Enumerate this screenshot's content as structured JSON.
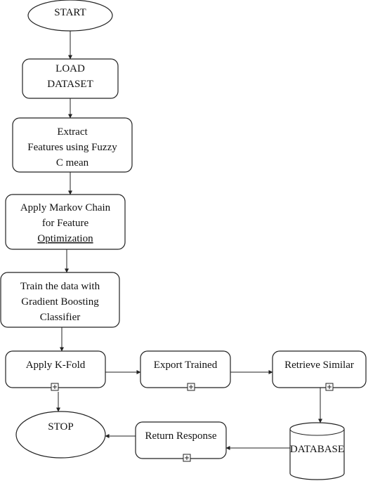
{
  "nodes": [
    {
      "id": "start",
      "shape": "ellipse",
      "lines": [
        "START"
      ]
    },
    {
      "id": "load",
      "shape": "rounded-rect",
      "lines": [
        "LOAD",
        "DATASET"
      ]
    },
    {
      "id": "extract",
      "shape": "rounded-rect",
      "lines": [
        "Extract",
        "Features using Fuzzy",
        "C mean"
      ]
    },
    {
      "id": "markov",
      "shape": "rounded-rect",
      "lines": [
        "Apply Markov Chain",
        "for Feature",
        "Optimization"
      ]
    },
    {
      "id": "train",
      "shape": "rounded-rect",
      "lines": [
        "Train the data with",
        "Gradient Boosting",
        "Classifier"
      ]
    },
    {
      "id": "kfold",
      "shape": "rounded-rect",
      "lines": [
        "Apply K-Fold"
      ],
      "expand_marker": true
    },
    {
      "id": "export",
      "shape": "rounded-rect",
      "lines": [
        "Export Trained"
      ],
      "expand_marker": true
    },
    {
      "id": "retrieve",
      "shape": "rounded-rect",
      "lines": [
        "Retrieve Similar"
      ],
      "expand_marker": true
    },
    {
      "id": "database",
      "shape": "cylinder",
      "lines": [
        "DATABASE"
      ]
    },
    {
      "id": "response",
      "shape": "rounded-rect",
      "lines": [
        "Return Response"
      ],
      "expand_marker": true
    },
    {
      "id": "stop",
      "shape": "ellipse",
      "lines": [
        "STOP"
      ]
    }
  ],
  "edges": [
    [
      "start",
      "load"
    ],
    [
      "load",
      "extract"
    ],
    [
      "extract",
      "markov"
    ],
    [
      "markov",
      "train"
    ],
    [
      "train",
      "kfold"
    ],
    [
      "kfold",
      "export"
    ],
    [
      "export",
      "retrieve"
    ],
    [
      "retrieve",
      "database"
    ],
    [
      "database",
      "response"
    ],
    [
      "response",
      "stop"
    ],
    [
      "kfold",
      "stop"
    ]
  ]
}
